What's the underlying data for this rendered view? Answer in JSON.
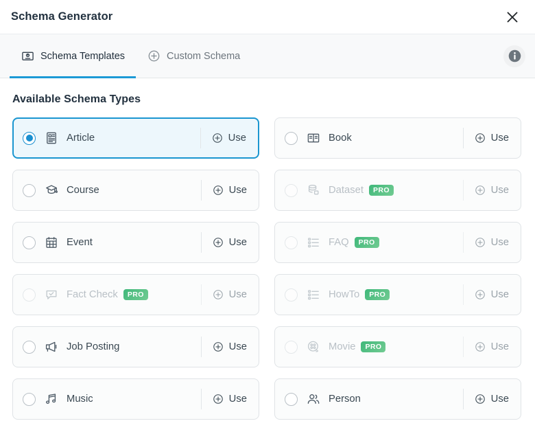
{
  "header": {
    "title": "Schema Generator",
    "close_label": "close-icon"
  },
  "tabs": [
    {
      "label": "Schema Templates",
      "icon": "schema-template-icon",
      "active": true
    },
    {
      "label": "Custom Schema",
      "icon": "plus-circle-icon",
      "active": false
    }
  ],
  "info_button": {
    "icon": "info-icon"
  },
  "main": {
    "section_title": "Available Schema Types",
    "use_label": "Use",
    "pro_label": "PRO",
    "accent_color": "#1a96d0",
    "selected_bg": "#edf7fc",
    "pro_color_start": "#3fb87a",
    "pro_color_end": "#72cb92",
    "cards": [
      {
        "label": "Article",
        "icon": "article-icon",
        "selected": true,
        "pro": false,
        "disabled": false,
        "use": "Use"
      },
      {
        "label": "Book",
        "icon": "book-icon",
        "selected": false,
        "pro": false,
        "disabled": false,
        "use": "Use"
      },
      {
        "label": "Course",
        "icon": "graduation-cap-icon",
        "selected": false,
        "pro": false,
        "disabled": false,
        "use": "Use"
      },
      {
        "label": "Dataset",
        "icon": "database-icon",
        "selected": false,
        "pro": true,
        "disabled": true,
        "use": "Use"
      },
      {
        "label": "Event",
        "icon": "calendar-icon",
        "selected": false,
        "pro": false,
        "disabled": false,
        "use": "Use"
      },
      {
        "label": "FAQ",
        "icon": "list-icon",
        "selected": false,
        "pro": true,
        "disabled": true,
        "use": "Use"
      },
      {
        "label": "Fact Check",
        "icon": "check-bubble-icon",
        "selected": false,
        "pro": true,
        "disabled": true,
        "use": "Use"
      },
      {
        "label": "HowTo",
        "icon": "list-icon",
        "selected": false,
        "pro": true,
        "disabled": true,
        "use": "Use"
      },
      {
        "label": "Job Posting",
        "icon": "megaphone-icon",
        "selected": false,
        "pro": false,
        "disabled": false,
        "use": "Use"
      },
      {
        "label": "Movie",
        "icon": "film-reel-icon",
        "selected": false,
        "pro": true,
        "disabled": true,
        "use": "Use"
      },
      {
        "label": "Music",
        "icon": "music-note-icon",
        "selected": false,
        "pro": false,
        "disabled": false,
        "use": "Use"
      },
      {
        "label": "Person",
        "icon": "people-icon",
        "selected": false,
        "pro": false,
        "disabled": false,
        "use": "Use"
      }
    ]
  }
}
